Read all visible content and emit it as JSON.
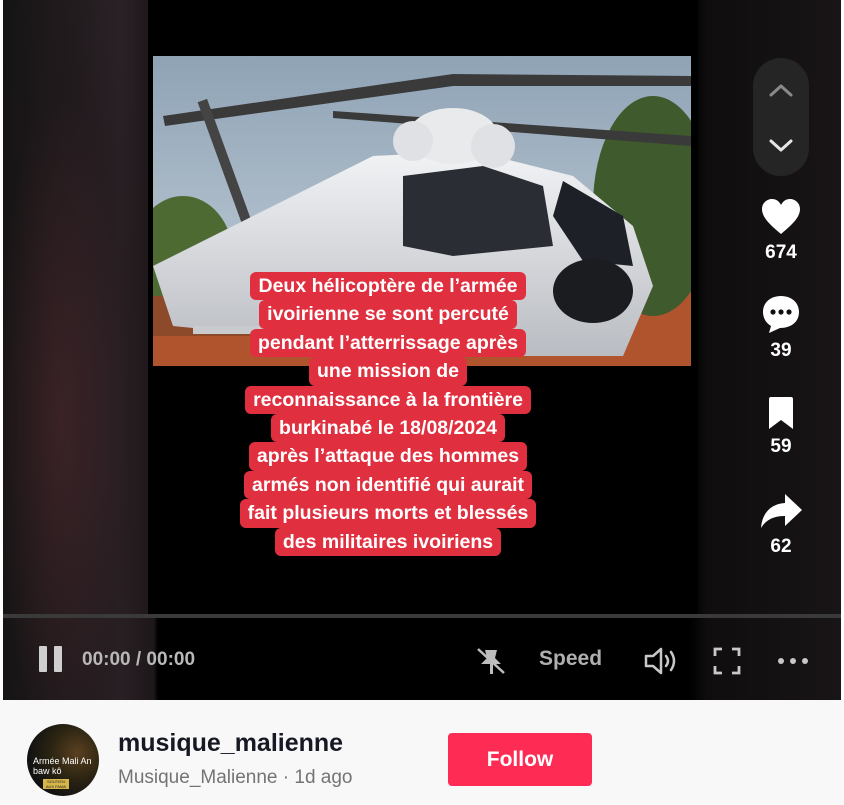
{
  "video": {
    "caption_lines": [
      "Deux hélicoptère de l’armée",
      "ivoirienne se sont percuté",
      "pendant l’atterrissage après",
      "une mission de",
      "reconnaissance à la frontière",
      "burkinabé le 18/08/2024",
      "après l’attaque des hommes",
      "armés non identifié qui aurait",
      "fait plusieurs morts et blessés",
      "des militaires ivoiriens"
    ],
    "caption_bg_color": "#e0303f"
  },
  "actions": {
    "likes": "674",
    "comments": "39",
    "saves": "59",
    "shares": "62"
  },
  "controls": {
    "time": "00:00 / 00:00",
    "speed_label": "Speed",
    "progress": 0
  },
  "author": {
    "username": "musique_malienne",
    "meta": "Musique_Malienne · 1d ago",
    "follow_label": "Follow",
    "avatar_text": "Armée Mali An baw kô",
    "avatar_badge": "SOUTIEN AUX FAMA"
  },
  "colors": {
    "accent": "#fe2c55"
  }
}
